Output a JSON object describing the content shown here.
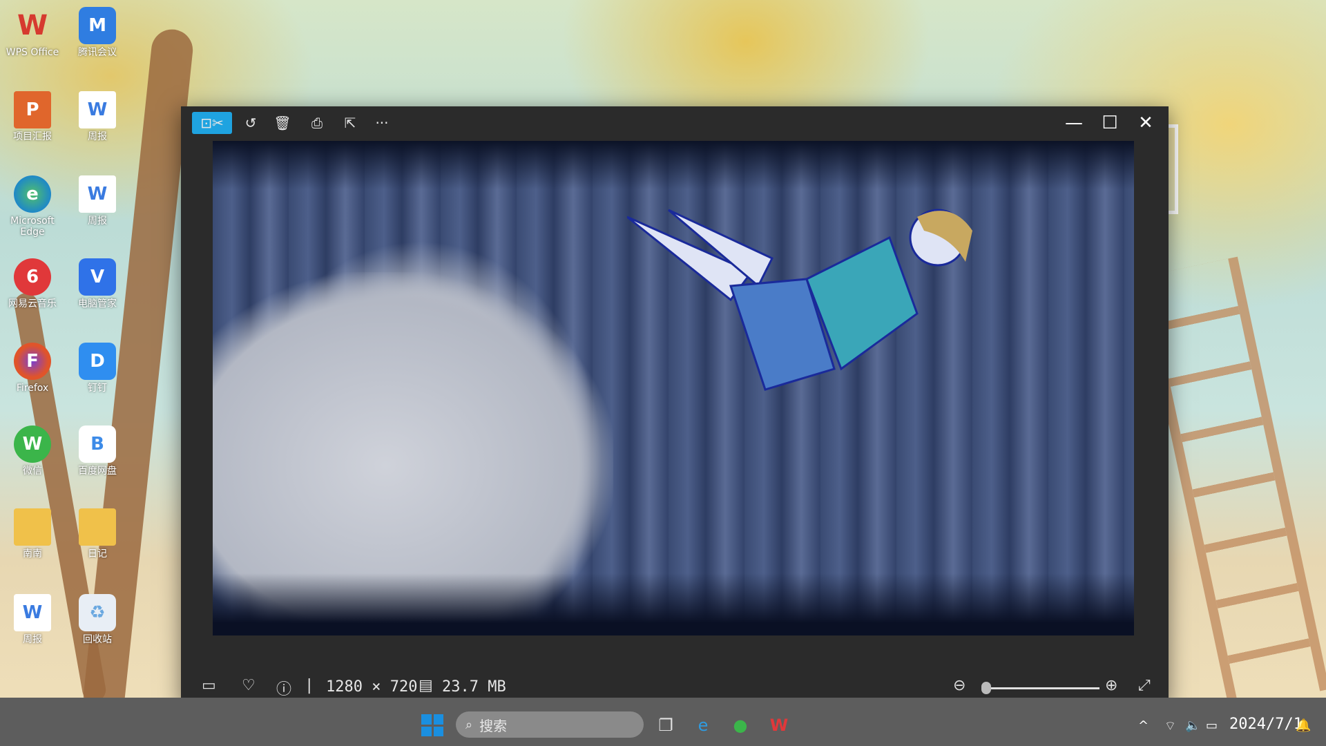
{
  "desktop": {
    "icons": [
      {
        "label": "WPS Office",
        "glyph": "W",
        "color": "#d63a2f"
      },
      {
        "label": "腾讯会议",
        "glyph": "M",
        "color": "#2f7de1"
      },
      {
        "label": "项目汇报",
        "glyph": "P",
        "color": "#e0662c"
      },
      {
        "label": "周报",
        "glyph": "W",
        "color": "#3a7be0"
      },
      {
        "label": "Microsoft Edge",
        "glyph": "e",
        "color": "#1e88c8"
      },
      {
        "label": "周报",
        "glyph": "W",
        "color": "#3a7be0"
      },
      {
        "label": "网易云音乐",
        "glyph": "6",
        "color": "#e0383a"
      },
      {
        "label": "电脑管家",
        "glyph": "V",
        "color": "#2f72e8"
      },
      {
        "label": "Firefox",
        "glyph": "F",
        "color": "#e0542a"
      },
      {
        "label": "钉钉",
        "glyph": "D",
        "color": "#2f8ef0"
      },
      {
        "label": "微信",
        "glyph": "W",
        "color": "#3bb54a"
      },
      {
        "label": "百度网盘",
        "glyph": "B",
        "color": "#3d8be8"
      },
      {
        "label": "南南",
        "glyph": "▬",
        "color": "#f0c14a"
      },
      {
        "label": "日记",
        "glyph": "▬",
        "color": "#f0c14a"
      },
      {
        "label": "周报",
        "glyph": "W",
        "color": "#3a7be0"
      },
      {
        "label": "回收站",
        "glyph": "♻",
        "color": "#6aa8e0"
      }
    ]
  },
  "viewer": {
    "toolbar": {
      "crop_icon": "crop-icon",
      "rotate_icon": "rotate-icon",
      "delete_icon": "trash-icon",
      "print_icon": "print-icon",
      "share_icon": "share-icon",
      "more_label": "···"
    },
    "window_controls": {
      "minimize": "—",
      "maximize": "☐",
      "close": "✕"
    },
    "status": {
      "resolution": "1280 × 720",
      "file_size": "23.7 MB",
      "zoom_level": 0.02
    }
  },
  "taskbar": {
    "search_placeholder": "搜索",
    "date": "2024/7/1",
    "tray_up": "^"
  }
}
